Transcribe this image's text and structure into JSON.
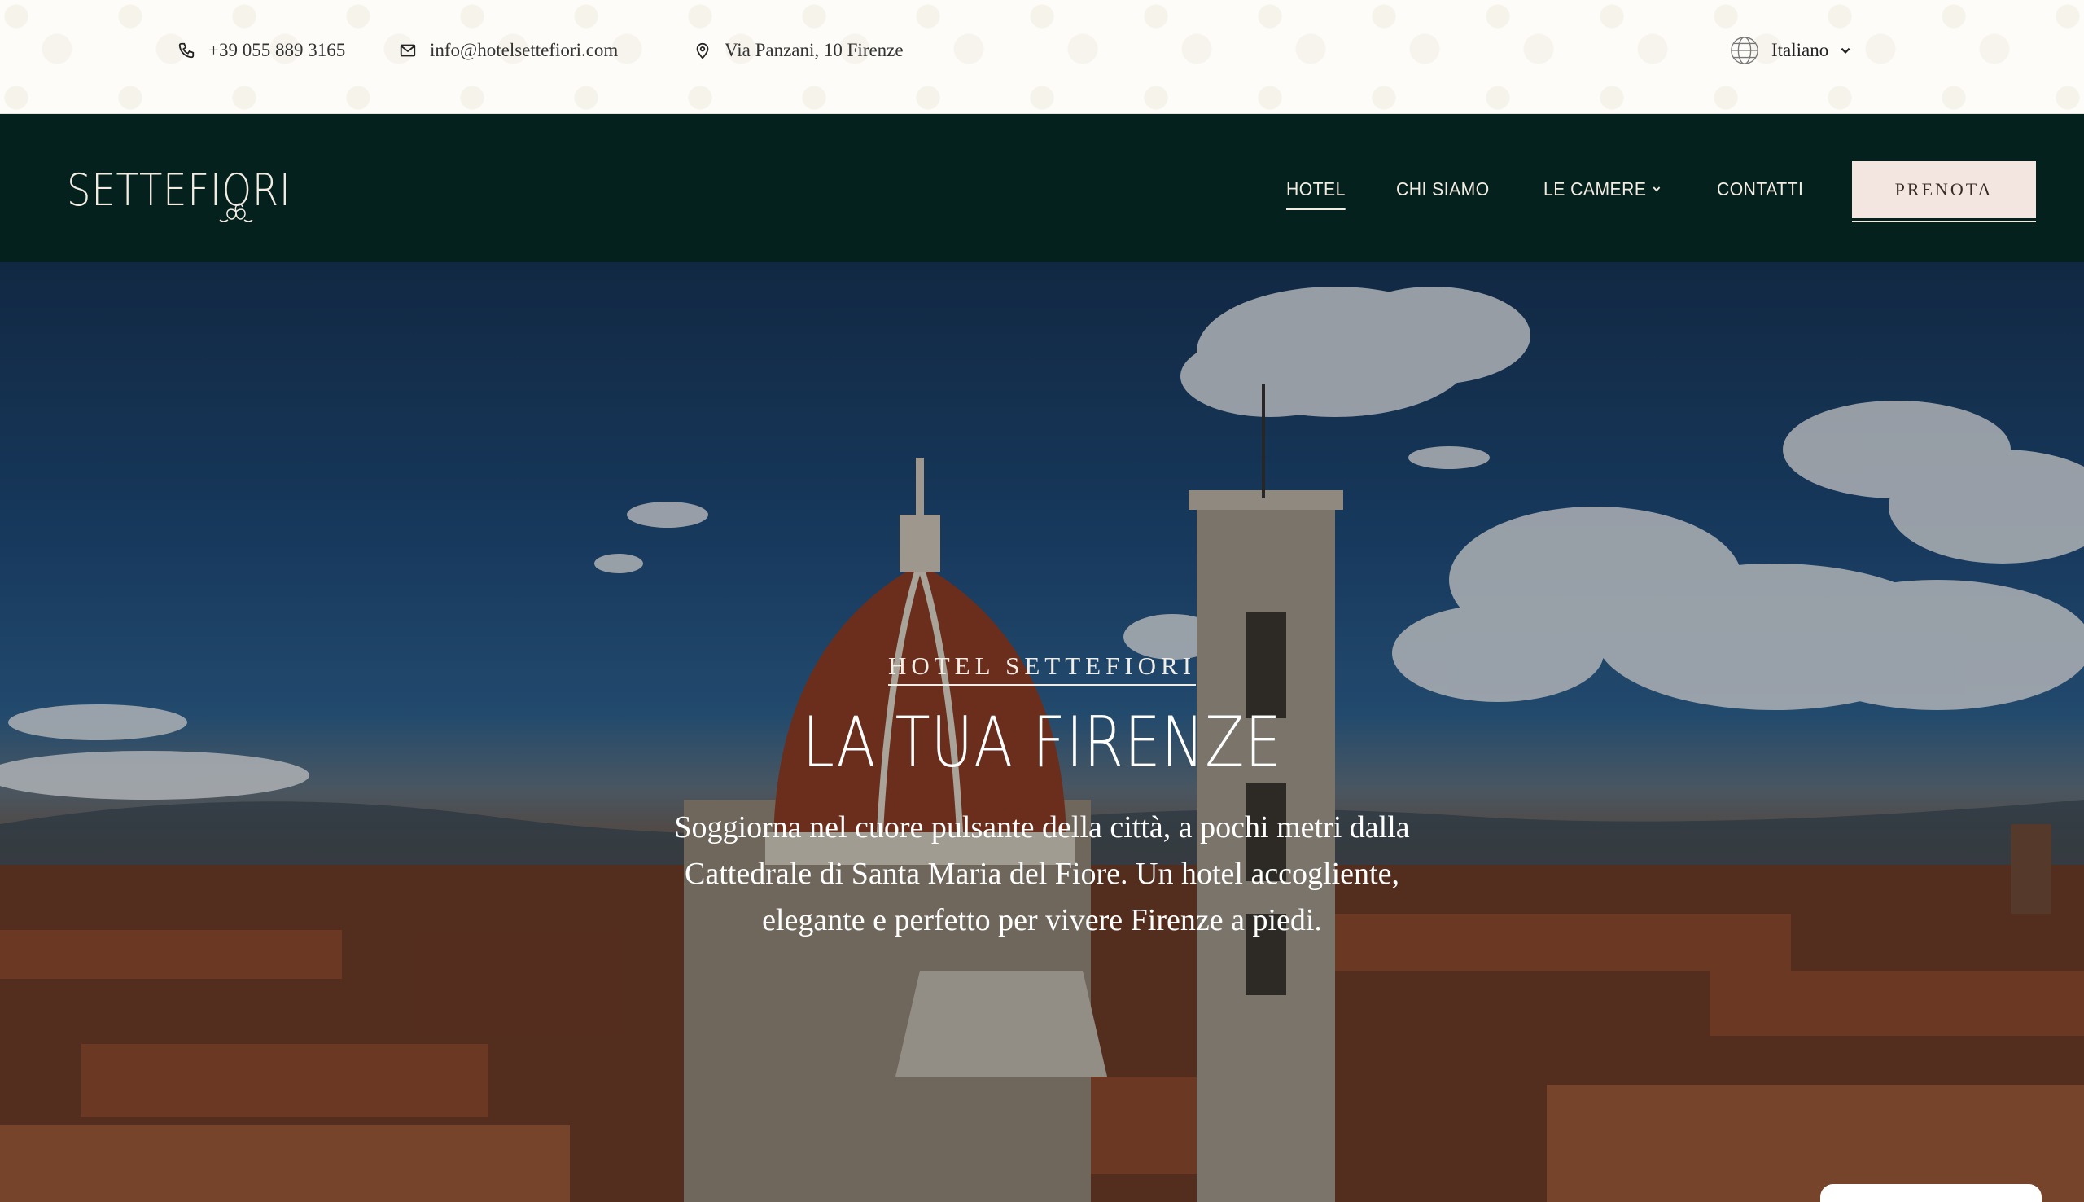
{
  "topbar": {
    "phone": "+39 055 889 3165",
    "email": "info@hotelsettefiori.com",
    "address": "Via Panzani, 10 Firenze",
    "language": "Italiano",
    "icons": [
      "phone-icon",
      "mail-icon",
      "map-pin-icon",
      "globe-icon"
    ]
  },
  "navbar": {
    "logo": "SETTEFIORI",
    "links": [
      {
        "label": "HOTEL",
        "active": true
      },
      {
        "label": "CHI SIAMO"
      },
      {
        "label": "LE CAMERE",
        "dropdown": true
      },
      {
        "label": "CONTATTI"
      }
    ],
    "cta": "PRENOTA"
  },
  "hero": {
    "eyebrow": "HOTEL SETTEFIORI",
    "title": "LA TUA FIRENZE",
    "text": "Soggiorna nel cuore pulsante della città, a pochi metri dalla Cattedrale di Santa Maria del Fiore. Un hotel accogliente, elegante e perfetto per vivere Firenze a piedi."
  },
  "colors": {
    "nav_bg": "#04211d",
    "nav_text": "#f3ece2",
    "cta_bg": "#f3e6e0",
    "topbar_bg": "#fdfcf8"
  }
}
